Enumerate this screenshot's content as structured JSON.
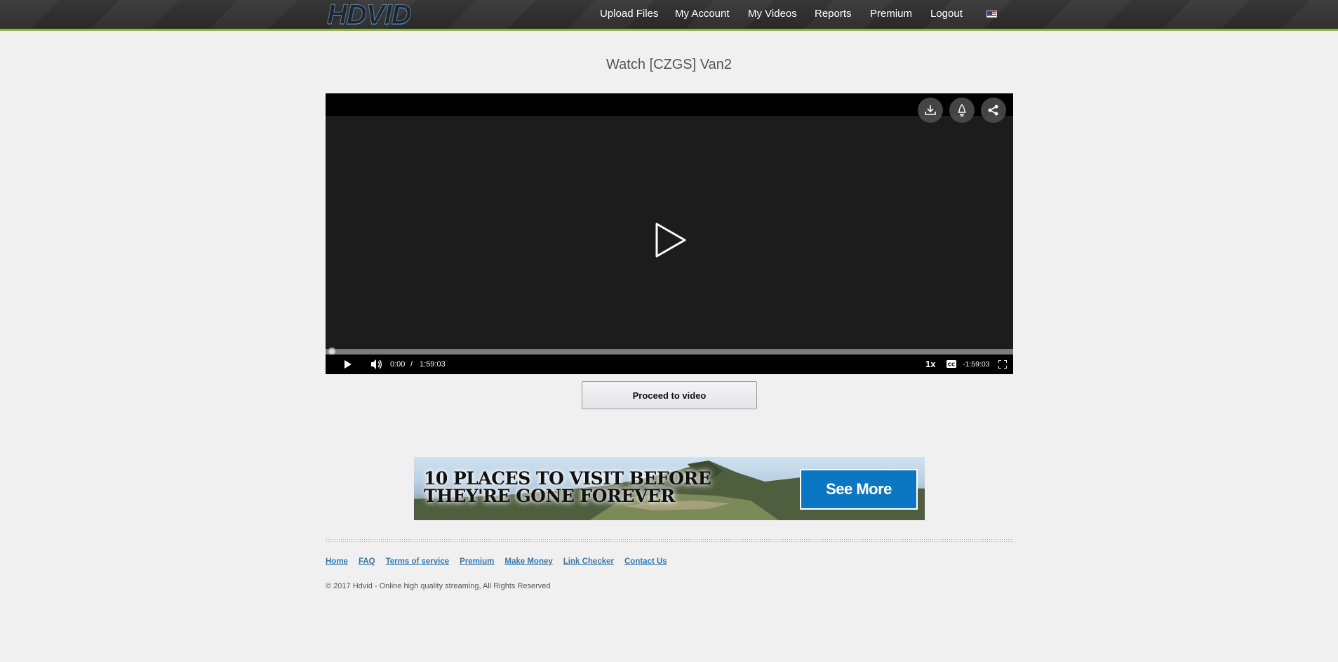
{
  "header": {
    "logo_text": "HDVID",
    "nav": [
      {
        "label": "Upload Files"
      },
      {
        "label": "My Account"
      },
      {
        "label": "My Videos"
      },
      {
        "label": "Reports"
      },
      {
        "label": "Premium"
      },
      {
        "label": "Logout"
      }
    ],
    "accent_color": "#8fb447"
  },
  "page": {
    "title": "Watch [CZGS] Van2"
  },
  "player": {
    "top_buttons": [
      "download-icon",
      "lightbulb-icon",
      "share-icon"
    ],
    "current_time": "0:00",
    "separator": "/",
    "duration": "1:59:03",
    "speed": "1x",
    "remaining": "-1:59:03",
    "progress": 0.0
  },
  "actions": {
    "proceed_label": "Proceed to video"
  },
  "ad": {
    "headline_line1": "10 PLACES TO VISIT BEFORE",
    "headline_line2": "THEY'RE GONE FOREVER",
    "button_label": "See More"
  },
  "footer": {
    "links": [
      {
        "label": "Home"
      },
      {
        "label": "FAQ"
      },
      {
        "label": "Terms of service"
      },
      {
        "label": "Premium"
      },
      {
        "label": "Make Money"
      },
      {
        "label": "Link Checker"
      },
      {
        "label": "Contact Us"
      }
    ],
    "copyright": "© 2017 Hdvid - Online high quality streaming, All Rights Reserved"
  }
}
